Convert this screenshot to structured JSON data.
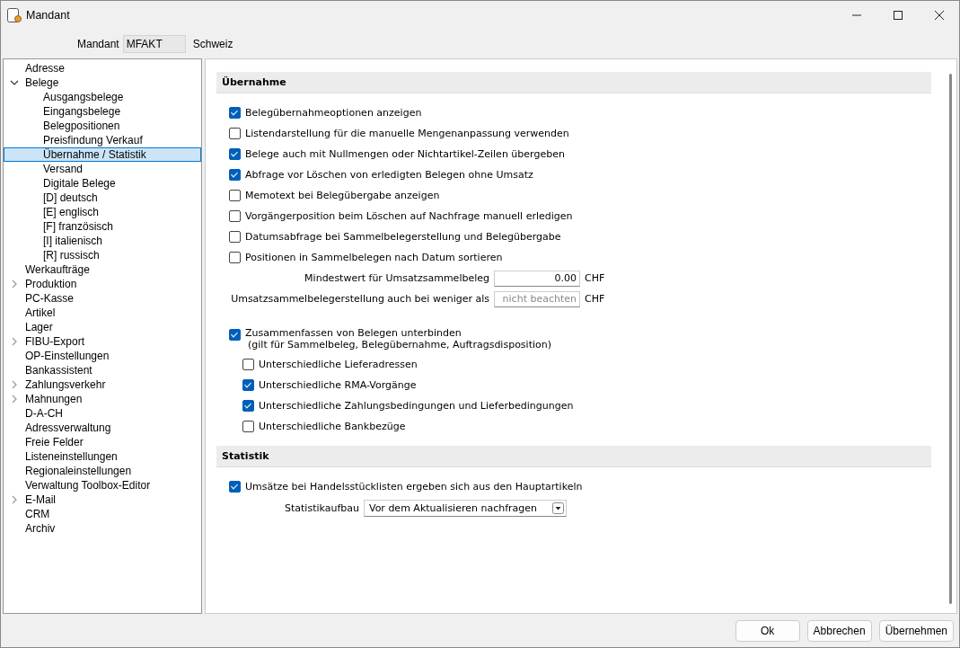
{
  "window": {
    "title": "Mandant"
  },
  "header": {
    "label": "Mandant",
    "value": "MFAKT",
    "country": "Schweiz"
  },
  "tree": [
    {
      "label": "Adresse",
      "selected": false
    },
    {
      "label": "Belege",
      "selected": false,
      "expanded": true,
      "children": [
        {
          "label": "Ausgangsbelege",
          "selected": false
        },
        {
          "label": "Eingangsbelege",
          "selected": false
        },
        {
          "label": "Belegpositionen",
          "selected": false
        },
        {
          "label": "Preisfindung Verkauf",
          "selected": false
        },
        {
          "label": "Übernahme / Statistik",
          "selected": true
        },
        {
          "label": "Versand",
          "selected": false
        },
        {
          "label": "Digitale Belege",
          "selected": false
        },
        {
          "label": "[D]  deutsch",
          "selected": false
        },
        {
          "label": "[E]  englisch",
          "selected": false
        },
        {
          "label": "[F]  französisch",
          "selected": false
        },
        {
          "label": "[I]  italienisch",
          "selected": false
        },
        {
          "label": "[R]  russisch",
          "selected": false
        }
      ]
    },
    {
      "label": "Werkaufträge",
      "selected": false
    },
    {
      "label": "Produktion",
      "selected": false,
      "expanded": false
    },
    {
      "label": "PC-Kasse",
      "selected": false
    },
    {
      "label": "Artikel",
      "selected": false
    },
    {
      "label": "Lager",
      "selected": false
    },
    {
      "label": "FIBU-Export",
      "selected": false,
      "expanded": false
    },
    {
      "label": "OP-Einstellungen",
      "selected": false
    },
    {
      "label": "Bankassistent",
      "selected": false
    },
    {
      "label": "Zahlungsverkehr",
      "selected": false,
      "expanded": false
    },
    {
      "label": "Mahnungen",
      "selected": false,
      "expanded": false
    },
    {
      "label": "D-A-CH",
      "selected": false
    },
    {
      "label": "Adressverwaltung",
      "selected": false
    },
    {
      "label": "Freie Felder",
      "selected": false
    },
    {
      "label": "Listeneinstellungen",
      "selected": false
    },
    {
      "label": "Regionaleinstellungen",
      "selected": false
    },
    {
      "label": "Verwaltung Toolbox-Editor",
      "selected": false
    },
    {
      "label": "E-Mail",
      "selected": false,
      "expanded": false
    },
    {
      "label": "CRM",
      "selected": false
    },
    {
      "label": "Archiv",
      "selected": false
    }
  ],
  "sections": [
    {
      "title": "Übernahme",
      "items": [
        {
          "kind": "checkbox",
          "label": "Belegübernahmeoptionen anzeigen",
          "checked": true
        },
        {
          "kind": "checkbox",
          "label": "Listendarstellung für die manuelle Mengenanpassung verwenden",
          "checked": false
        },
        {
          "kind": "checkbox",
          "label": "Belege auch mit Nullmengen oder Nichtartikel-Zeilen übergeben",
          "checked": true
        },
        {
          "kind": "checkbox",
          "label": "Abfrage vor Löschen von erledigten Belegen ohne Umsatz",
          "checked": true
        },
        {
          "kind": "checkbox",
          "label": "Memotext bei Belegübergabe anzeigen",
          "checked": false
        },
        {
          "kind": "checkbox",
          "label": "Vorgängerposition beim Löschen auf Nachfrage manuell erledigen",
          "checked": false
        },
        {
          "kind": "checkbox",
          "label": "Datumsabfrage bei Sammelbelegerstellung und Belegübergabe",
          "checked": false
        },
        {
          "kind": "checkbox",
          "label": "Positionen in Sammelbelegen nach Datum sortieren",
          "checked": false
        },
        {
          "kind": "field",
          "label": "Mindestwert für Umsatzsammelbeleg",
          "value": "0.00",
          "unit": "CHF"
        },
        {
          "kind": "field",
          "label": "Umsatzsammelbelegerstellung auch bei weniger als",
          "placeholder": "nicht beachten",
          "unit": "CHF"
        },
        {
          "kind": "group",
          "label": "Zusammenfassen von Belegen unterbinden",
          "note": "(gilt für Sammelbeleg, Belegübernahme, Auftragsdisposition)",
          "checked": true,
          "children": [
            {
              "label": "Unterschiedliche Lieferadressen",
              "checked": false
            },
            {
              "label": "Unterschiedliche RMA-Vorgänge",
              "checked": true
            },
            {
              "label": "Unterschiedliche Zahlungsbedingungen und Lieferbedingungen",
              "checked": true
            },
            {
              "label": "Unterschiedliche Bankbezüge",
              "checked": false
            }
          ]
        }
      ]
    },
    {
      "title": "Statistik",
      "items": [
        {
          "kind": "checkbox",
          "label": "Umsätze bei Handelsstücklisten ergeben sich aus den Hauptartikeln",
          "checked": true
        },
        {
          "kind": "select",
          "label": "Statistikaufbau",
          "value": "Vor dem Aktualisieren nachfragen"
        }
      ]
    }
  ],
  "buttons": [
    "Ok",
    "Abbrechen",
    "Übernehmen"
  ]
}
